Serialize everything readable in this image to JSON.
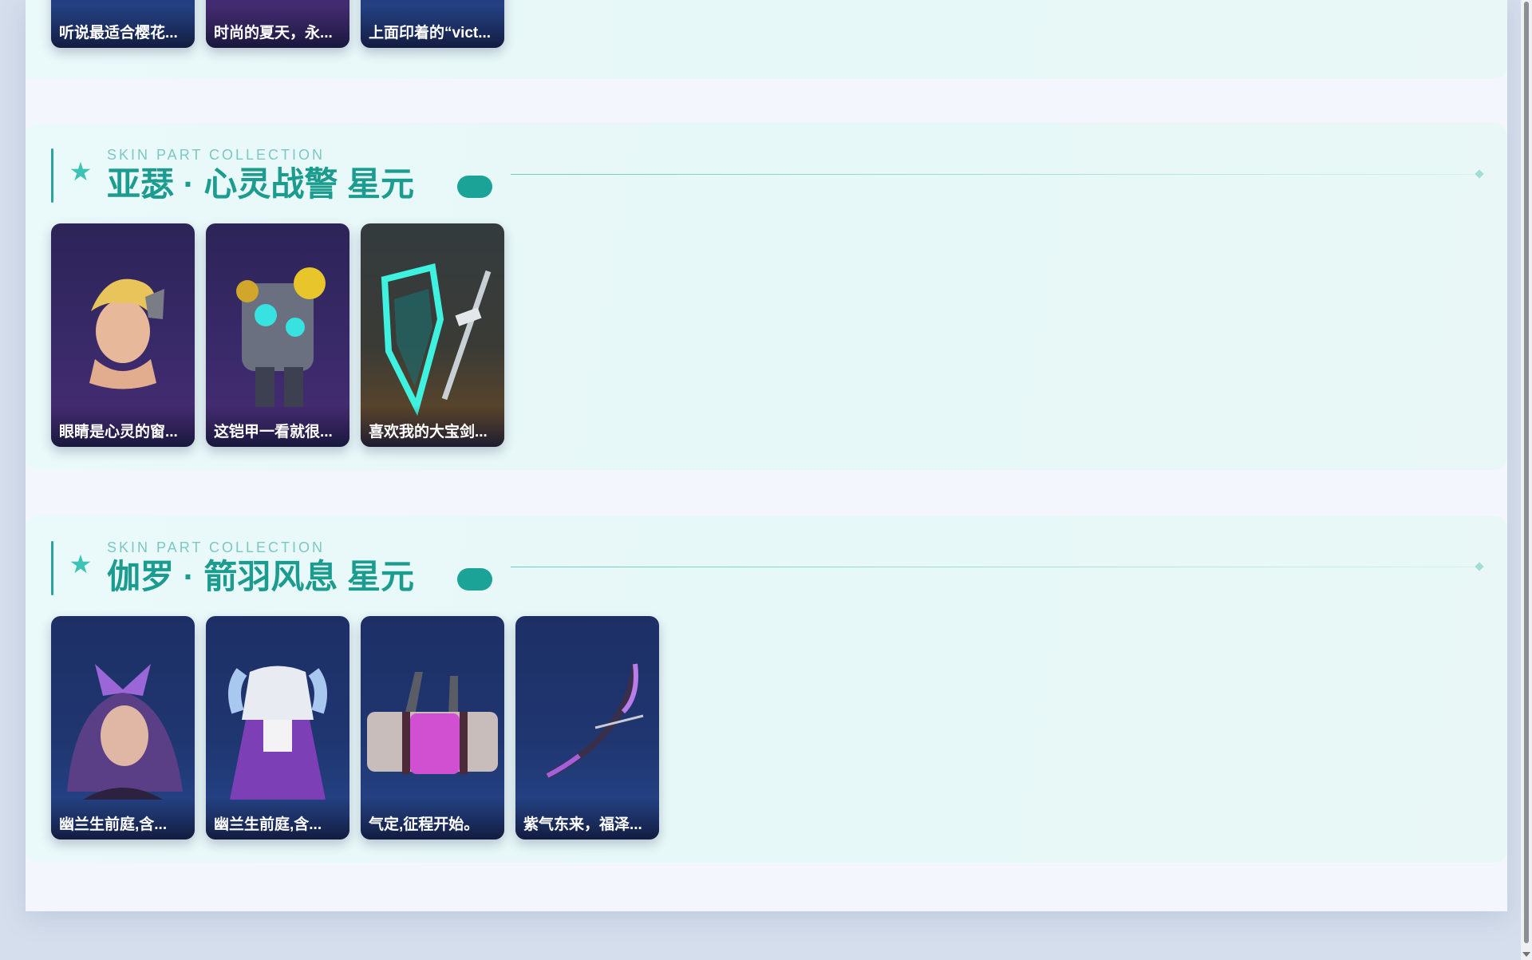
{
  "top_section": {
    "cards": [
      {
        "caption": "听说最适合樱花...",
        "palette": "blue"
      },
      {
        "caption": "时尚的夏天，永...",
        "palette": "purple"
      },
      {
        "caption": "上面印着的“vict...",
        "palette": "blue"
      }
    ]
  },
  "sections": [
    {
      "eyebrow": "SKIN PART COLLECTION",
      "title": "亚瑟 · 心灵战警 星元",
      "cards": [
        {
          "caption": "眼睛是心灵的窗...",
          "icon": "hero-head-icon",
          "palette": "purple"
        },
        {
          "caption": "这铠甲一看就很...",
          "icon": "armor-icon",
          "palette": "purple"
        },
        {
          "caption": "喜欢我的大宝剑...",
          "icon": "sword-shield-icon",
          "palette": "brown"
        }
      ]
    },
    {
      "eyebrow": "SKIN PART COLLECTION",
      "title": "伽罗 · 箭羽风息 星元",
      "cards": [
        {
          "caption": "幽兰生前庭,含...",
          "icon": "hero-head-icon",
          "palette": "blue"
        },
        {
          "caption": "幽兰生前庭,含...",
          "icon": "outfit-icon",
          "palette": "blue"
        },
        {
          "caption": "气定,征程开始。",
          "icon": "bag-icon",
          "palette": "blue"
        },
        {
          "caption": "紫气东来，福泽...",
          "icon": "bow-icon",
          "palette": "blue"
        }
      ]
    }
  ],
  "colors": {
    "accent": "#1b9c8e",
    "pill": "#1aa396",
    "section_bg": "#e6f8f7",
    "page_bg": "#d5deec"
  }
}
